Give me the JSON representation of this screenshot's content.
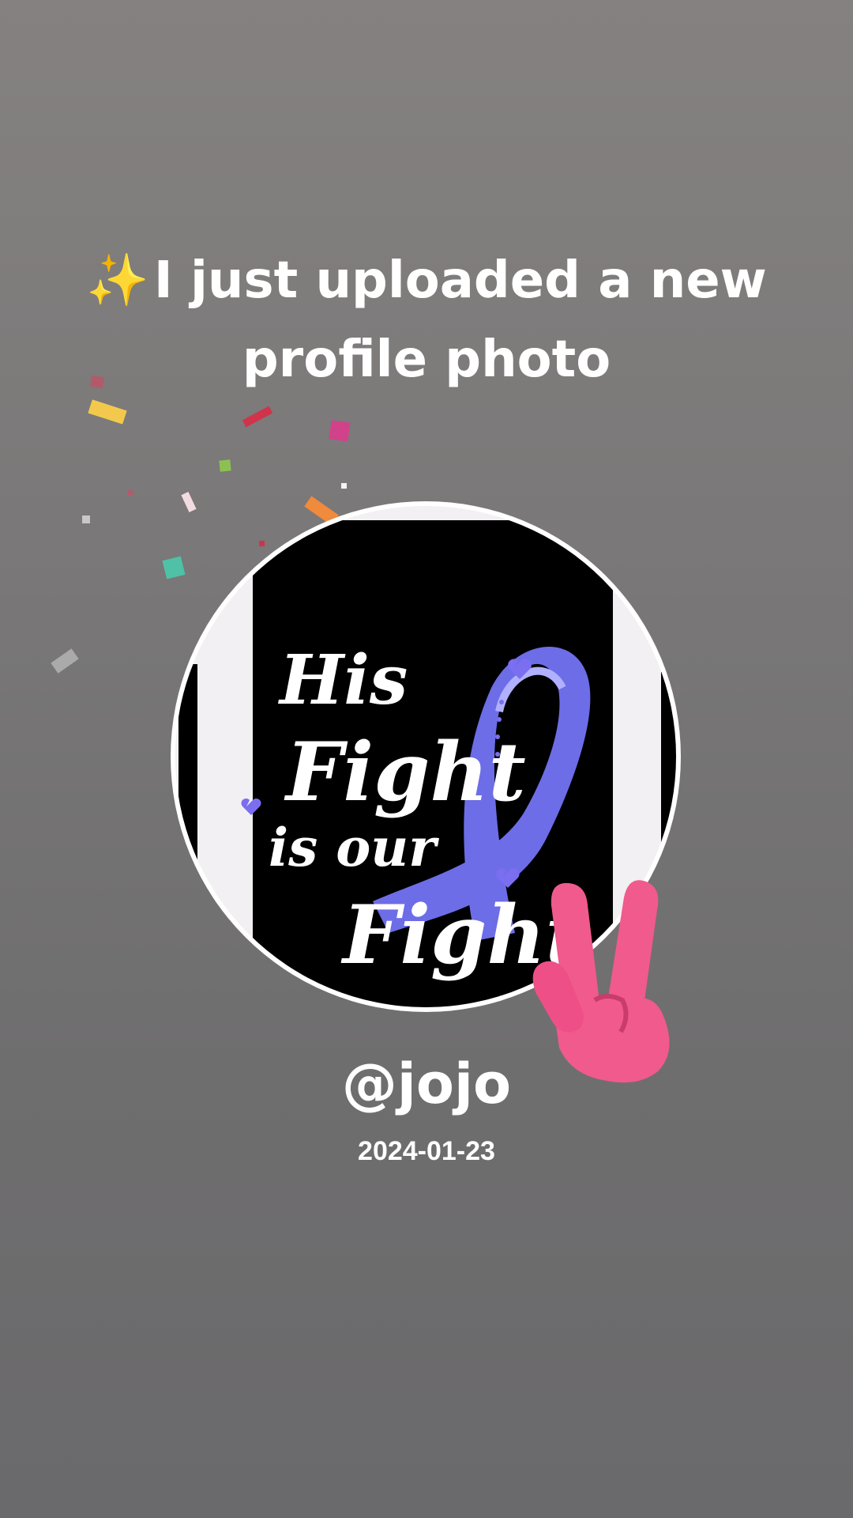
{
  "story": {
    "headline_icon": "sparkles-icon",
    "headline": "I just uploaded a new profile photo",
    "username": "@jojo",
    "date": "2024-01-23"
  },
  "profile_photo": {
    "artwork_text": [
      "His",
      "Fight",
      "is our",
      "Fight"
    ],
    "ribbon_color": "#6d6de8"
  },
  "decorations": {
    "confetti_icon": "confetti-icon",
    "hand_icon": "peace-sign-hand-icon",
    "hand_color": "#f05a8c"
  }
}
